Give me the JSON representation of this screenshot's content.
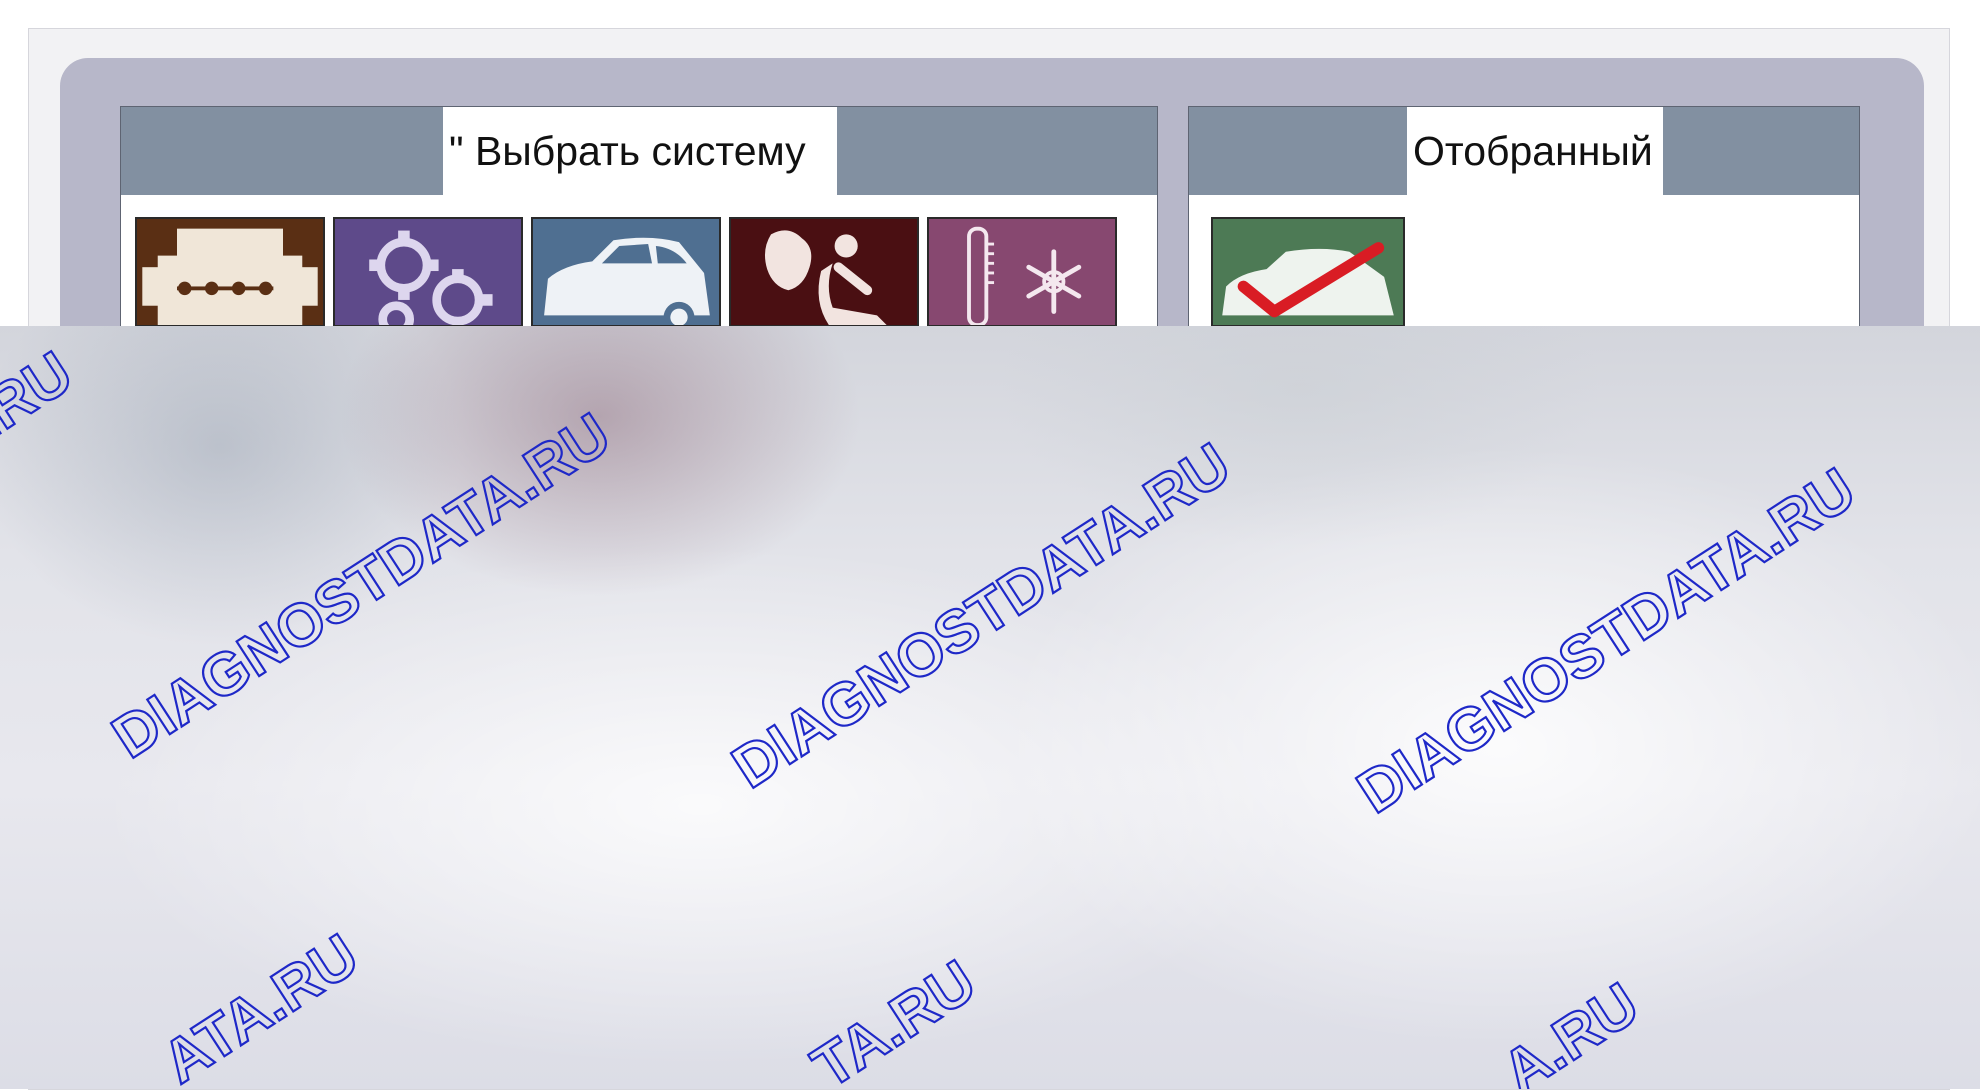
{
  "left_pane": {
    "tab_label": "\" Выбрать систему",
    "icons": [
      {
        "name": "engine-icon",
        "bg": "#5a2f14"
      },
      {
        "name": "transmission-gears-icon",
        "bg": "#5e4a8a"
      },
      {
        "name": "chassis-car-icon",
        "bg": "#4f6f91"
      },
      {
        "name": "airbag-seat-icon",
        "bg": "#4a0f12"
      },
      {
        "name": "climate-control-icon",
        "bg": "#874870"
      }
    ]
  },
  "right_pane": {
    "tab_label": "Отобранный",
    "icons": [
      {
        "name": "selected-car-checkmark-icon",
        "bg": "#4d7a55"
      }
    ]
  },
  "watermark": {
    "text_long": "DIAGNOSTDATA.RU",
    "text_partial_1": ".RU",
    "text_partial_2": "ATA.RU",
    "text_partial_3": "TA.RU",
    "text_partial_4": "A.RU",
    "color": "#1e28c8"
  }
}
